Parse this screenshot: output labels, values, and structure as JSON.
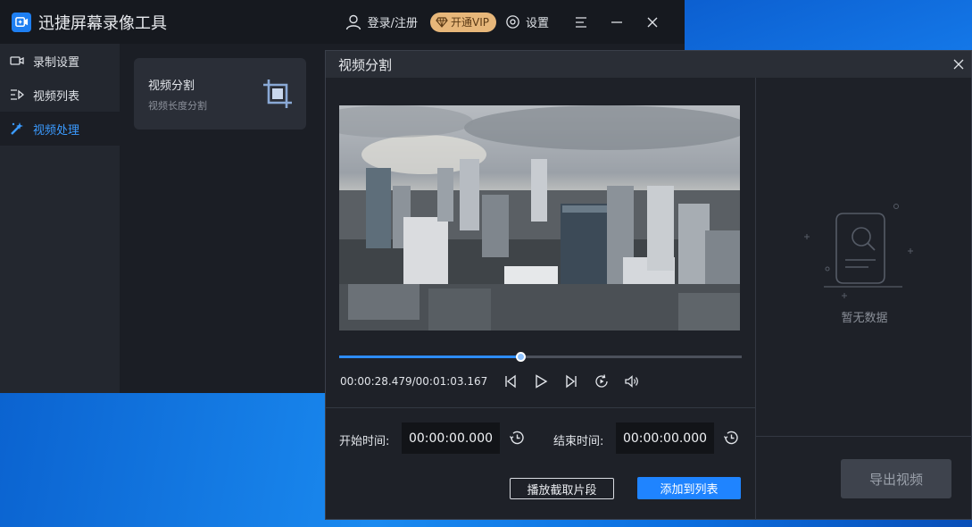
{
  "app": {
    "title": "迅捷屏幕录像工具",
    "login_label": "登录/注册",
    "vip_label": "开通VIP",
    "settings_label": "设置"
  },
  "sidebar": {
    "items": [
      {
        "label": "录制设置",
        "icon": "camera-icon",
        "active": false
      },
      {
        "label": "视频列表",
        "icon": "list-play-icon",
        "active": false
      },
      {
        "label": "视频处理",
        "icon": "magic-wand-icon",
        "active": true
      }
    ]
  },
  "tool_card": {
    "title": "视频分割",
    "subtitle": "视频长度分割",
    "icon": "crop-icon"
  },
  "dialog": {
    "title": "视频分割",
    "playback": {
      "current_time": "00:00:28.479",
      "total_time": "00:01:03.167",
      "time_display": "00:00:28.479/00:01:03.167",
      "progress_fraction": 0.451
    },
    "start_time_label": "开始时间:",
    "start_time_value": "00:00:00.000",
    "end_time_label": "结束时间:",
    "end_time_value": "00:00:00.000",
    "play_clip_button": "播放截取片段",
    "add_to_list_button": "添加到列表",
    "empty_text": "暂无数据",
    "export_button": "导出视频"
  },
  "colors": {
    "accent": "#1f84ff",
    "vip_gold": "#e7b77a",
    "active_text": "#3b9bff"
  }
}
